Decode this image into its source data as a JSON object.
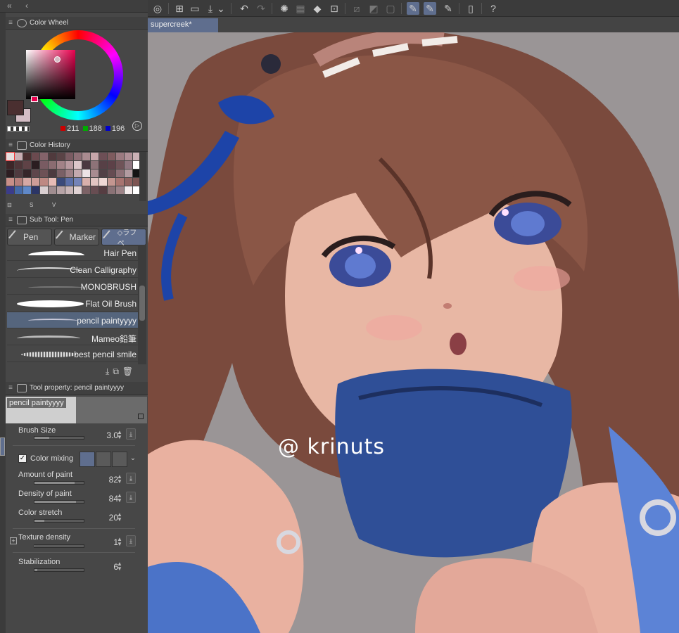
{
  "toolbar": {
    "icons": [
      "clip-logo-icon",
      "new-canvas-icon",
      "open-icon",
      "export-icon",
      "dropdown-icon",
      "undo-icon",
      "redo-icon",
      "loading-icon",
      "clear-icon",
      "fill-icon",
      "transform-icon",
      "hide-selection-icon",
      "snap-ruler-icon",
      "snap-grid-icon",
      "pen-stabilize-icon",
      "pen-pressure-icon",
      "pen-tilt-icon",
      "smartphone-icon",
      "help-icon"
    ]
  },
  "document": {
    "tab_label": "supercreek*"
  },
  "color_wheel": {
    "title": "Color Wheel",
    "r": "211",
    "g": "188",
    "b": "196",
    "main_color": "#4a2f30",
    "sub_color": "#d3bcc4"
  },
  "color_history": {
    "title": "Color History",
    "tools": [
      "⊟",
      "S",
      "V"
    ],
    "swatches": [
      "#e6dede",
      "#c9aeb3",
      "#4a2f30",
      "#6b4a4f",
      "#84636a",
      "#503a3d",
      "#5a4346",
      "#7a5b62",
      "#8e6f76",
      "#aa8b90",
      "#c7a6aa",
      "#6d4f56",
      "#7e5b5e",
      "#9b7a80",
      "#b09097",
      "#cbb1b5",
      "#3d2628",
      "#4e3538",
      "#5f4246",
      "#2a1d20",
      "#795b62",
      "#8a6c71",
      "#a28287",
      "#b99aa0",
      "#dcc7ca",
      "#4a3840",
      "#8d7378",
      "#574046",
      "#5d4148",
      "#6f5358",
      "#8f7680",
      "#ffffff",
      "#2d1e22",
      "#4f3a3f",
      "#36262a",
      "#5e464b",
      "#6e5156",
      "#4c3a3f",
      "#7a6066",
      "#9d7f85",
      "#c4a9ae",
      "#ede3e5",
      "#a98c91",
      "#524046",
      "#664c52",
      "#8d7076",
      "#b29ba0",
      "#141414",
      "#c88f88",
      "#b57f7b",
      "#d6a8a4",
      "#cd9d98",
      "#be8983",
      "#e7bcb6",
      "#3a4a7a",
      "#5a6ea8",
      "#7483b8",
      "#d8b0ac",
      "#e2c5c2",
      "#f0d8d5",
      "#c49690",
      "#a87470",
      "#90625f",
      "#7d5552",
      "#3b3c8a",
      "#456aa8",
      "#5f88c8",
      "#2b3566",
      "#d9cfd1",
      "#a08d90",
      "#b7a4a7",
      "#c9b6b8",
      "#e0d2d4",
      "#7c6266",
      "#684d52",
      "#563d42",
      "#8a7276",
      "#9e8488",
      "#f4ecec",
      "#ffffff"
    ]
  },
  "subtool": {
    "title": "Sub Tool: Pen",
    "tabs": [
      "Pen",
      "Marker",
      "◇ラフペ"
    ],
    "brushes": [
      "Hair Pen",
      "Clean Calligraphy",
      "MONOBRUSH",
      "Flat Oil Brush",
      "pencil paintyyyy",
      "Mameo鉛筆",
      "best pencil smile"
    ]
  },
  "tool_property": {
    "title": "Tool property: pencil paintyyyy",
    "preview_name": "pencil paintyyyy",
    "brush_size_label": "Brush Size",
    "brush_size": "3.0",
    "color_mixing_label": "Color mixing",
    "amount_label": "Amount of paint",
    "amount": "82",
    "density_label": "Density of paint",
    "density": "84",
    "stretch_label": "Color stretch",
    "stretch": "20",
    "texture_label": "Texture density",
    "texture": "1",
    "stabilization_label": "Stabilization",
    "stabilization": "6"
  },
  "canvas": {
    "watermark": "@ krinuts"
  }
}
